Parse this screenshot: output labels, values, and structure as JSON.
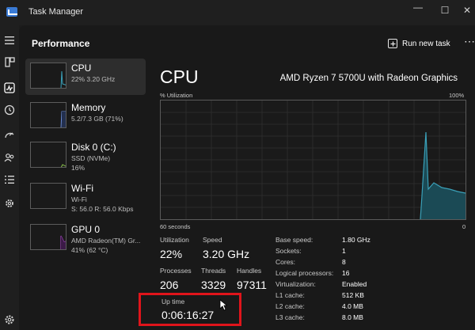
{
  "window": {
    "title": "Task Manager",
    "controls": {
      "minimize": "—",
      "maximize": "☐",
      "close": "✕"
    }
  },
  "nav_icons": [
    "hamburger-icon",
    "processes-icon",
    "performance-icon",
    "app-history-icon",
    "startup-apps-icon",
    "users-icon",
    "details-icon",
    "services-icon",
    "settings-icon"
  ],
  "header": {
    "title": "Performance",
    "run_new_task": "Run new task",
    "more": "⋯"
  },
  "resources": [
    {
      "name": "CPU",
      "sub": [
        "22% 3.20 GHz"
      ],
      "selected": true
    },
    {
      "name": "Memory",
      "sub": [
        "5.2/7.3 GB (71%)"
      ]
    },
    {
      "name": "Disk 0 (C:)",
      "sub": [
        "SSD (NVMe)",
        "16%"
      ]
    },
    {
      "name": "Wi-Fi",
      "sub": [
        "Wi-Fi",
        "S: 56.0 R: 56.0 Kbps"
      ]
    },
    {
      "name": "GPU 0",
      "sub": [
        "AMD Radeon(TM) Gr...",
        "41% (62 °C)"
      ]
    }
  ],
  "cpu": {
    "heading": "CPU",
    "model": "AMD Ryzen 7 5700U with Radeon Graphics",
    "graph_label_left": "% Utilization",
    "graph_label_right": "100%",
    "graph_bottom_left": "60 seconds",
    "graph_bottom_right": "0",
    "stats": {
      "utilization_label": "Utilization",
      "utilization": "22%",
      "speed_label": "Speed",
      "speed": "3.20 GHz",
      "processes_label": "Processes",
      "processes": "206",
      "threads_label": "Threads",
      "threads": "3329",
      "handles_label": "Handles",
      "handles": "97311",
      "uptime_label": "Up time",
      "uptime": "0:06:16:27"
    },
    "specs": [
      {
        "label": "Base speed:",
        "value": "1.80 GHz"
      },
      {
        "label": "Sockets:",
        "value": "1"
      },
      {
        "label": "Cores:",
        "value": "8"
      },
      {
        "label": "Logical processors:",
        "value": "16"
      },
      {
        "label": "Virtualization:",
        "value": "Enabled"
      },
      {
        "label": "L1 cache:",
        "value": "512 KB"
      },
      {
        "label": "L2 cache:",
        "value": "4.0 MB"
      },
      {
        "label": "L3 cache:",
        "value": "8.0 MB"
      }
    ]
  },
  "colors": {
    "cpu_line": "#3aa0b8",
    "cpu_fill": "#1b4a55",
    "memory_line": "#6a8cd6",
    "disk_line": "#8bc34a",
    "gpu_line": "#b04ad0",
    "highlight": "#e0141b"
  }
}
